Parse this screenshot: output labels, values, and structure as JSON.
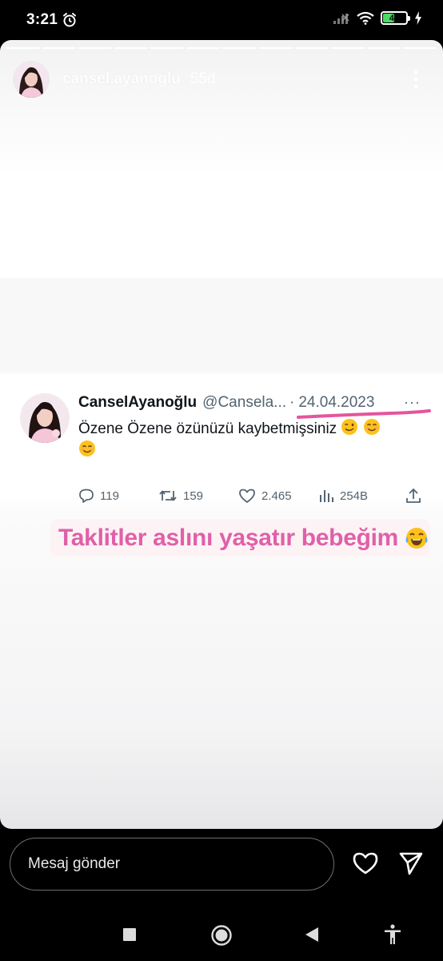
{
  "status_bar": {
    "time": "3:21",
    "battery": "48",
    "icons": [
      "alarm-icon",
      "signal-icon",
      "wifi-icon",
      "battery-icon",
      "charging-icon"
    ]
  },
  "story": {
    "username": "cansel.ayanoglu",
    "age": "55d",
    "progress_segments": 12
  },
  "tweet": {
    "display_name": "CanselAyanoğlu",
    "handle": "@Cansela...",
    "separator": "·",
    "date": "24.04.2023",
    "more": "···",
    "text": "Özene Özene özünüzü kaybetmişsiniz",
    "actions": {
      "replies": "119",
      "retweets": "159",
      "likes": "2.465",
      "views": "254B"
    }
  },
  "caption": {
    "text": "Taklitler aslını yaşatır bebeğim"
  },
  "reply_bar": {
    "placeholder": "Mesaj gönder"
  },
  "colors": {
    "caption_pink": "#e060a8",
    "underline_pink": "#e4559c",
    "tweet_text": "#0f1419",
    "tweet_secondary": "#536471"
  }
}
